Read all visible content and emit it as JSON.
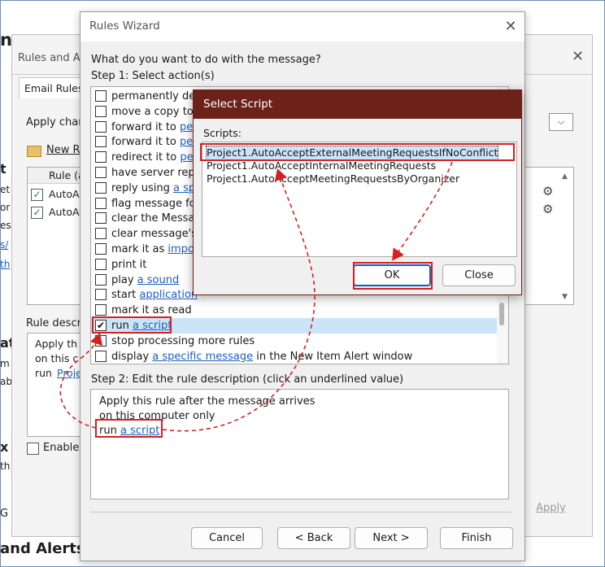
{
  "background": {
    "fragments": {
      "top_n": "n",
      "rules_and_a": "Rules and A",
      "email_rules_tab": "Email Rules",
      "apply_changes": "Apply chan",
      "new_rule": "New R",
      "rule_col": "Rule (a",
      "rule_1": "AutoA",
      "rule_2": "AutoA",
      "rule_description": "Rule descri",
      "desc_apply": "Apply th",
      "desc_on_this": "on this c",
      "desc_run": "run",
      "desc_project": "Proje",
      "enable": "Enable",
      "apply_button": "Apply",
      "and_alerts": "and Alerts",
      "left_t": "t",
      "left_et": "et",
      "left_or": "or",
      "left_es": "es",
      "left_s": "s/",
      "left_th": "th",
      "left_at": "at",
      "left_m": "m",
      "left_ab": "ab",
      "left_x": "x",
      "left_th2": "th",
      "left_g": "G"
    },
    "close_glyph": "✕",
    "combo_arrow": "⌵",
    "scroll_up": "▲",
    "scroll_down": "▼",
    "gear_glyph": "⚙"
  },
  "wizard": {
    "title": "Rules Wizard",
    "close_glyph": "✕",
    "question": "What do you want to do with the message?",
    "step1": "Step 1: Select action(s)",
    "actions": [
      {
        "text": "permanently de",
        "link": "",
        "after": "",
        "checked": false
      },
      {
        "text": "move a copy to",
        "link": "",
        "after": "",
        "checked": false
      },
      {
        "text": "forward it to ",
        "link": "pe",
        "after": "",
        "checked": false
      },
      {
        "text": "forward it to ",
        "link": "pe",
        "after": "",
        "checked": false
      },
      {
        "text": "redirect it to ",
        "link": "pe",
        "after": "",
        "checked": false
      },
      {
        "text": "have server repl",
        "link": "",
        "after": "",
        "checked": false
      },
      {
        "text": "reply using ",
        "link": "a sp",
        "after": "",
        "checked": false
      },
      {
        "text": "flag message fo",
        "link": "",
        "after": "",
        "checked": false
      },
      {
        "text": "clear the Messa",
        "link": "",
        "after": "",
        "checked": false
      },
      {
        "text": "clear message's",
        "link": "",
        "after": "",
        "checked": false
      },
      {
        "text": "mark it as ",
        "link": "impo",
        "after": "",
        "checked": false
      },
      {
        "text": "print it",
        "link": "",
        "after": "",
        "checked": false
      },
      {
        "text": "play ",
        "link": "a sound",
        "after": "",
        "checked": false
      },
      {
        "text": "start ",
        "link": "application",
        "after": "",
        "checked": false
      },
      {
        "text": "mark it as read",
        "link": "",
        "after": "",
        "checked": false
      },
      {
        "text": "run ",
        "link": "a script",
        "after": "",
        "checked": true
      },
      {
        "text": "stop processing more rules",
        "link": "",
        "after": "",
        "checked": false
      },
      {
        "text": "display ",
        "link": "a specific message",
        "after": " in the New Item Alert window",
        "checked": false
      }
    ],
    "check_glyph": "✔",
    "step2": "Step 2: Edit the rule description (click an underlined value)",
    "desc_line1": "Apply this rule after the message arrives",
    "desc_line2": "on this computer only",
    "desc_run": "run ",
    "desc_link": "a script",
    "buttons": {
      "cancel": "Cancel",
      "back": "< Back",
      "next": "Next >",
      "finish": "Finish"
    }
  },
  "select_script": {
    "title": "Select Script",
    "scripts_label": "Scripts:",
    "scripts": [
      "Project1.AutoAcceptExternalMeetingRequestsIfNoConflict",
      "Project1.AutoAcceptInternalMeetingRequests",
      "Project1.AutoAcceptMeetingRequestsByOrganizer"
    ],
    "selected_index": 0,
    "ok": "OK",
    "close": "Close"
  },
  "colors": {
    "callout_red": "#d62020",
    "dialog_title_bg": "#6d2219",
    "selection_bg": "#cce4f7",
    "link": "#1f5fbf"
  }
}
